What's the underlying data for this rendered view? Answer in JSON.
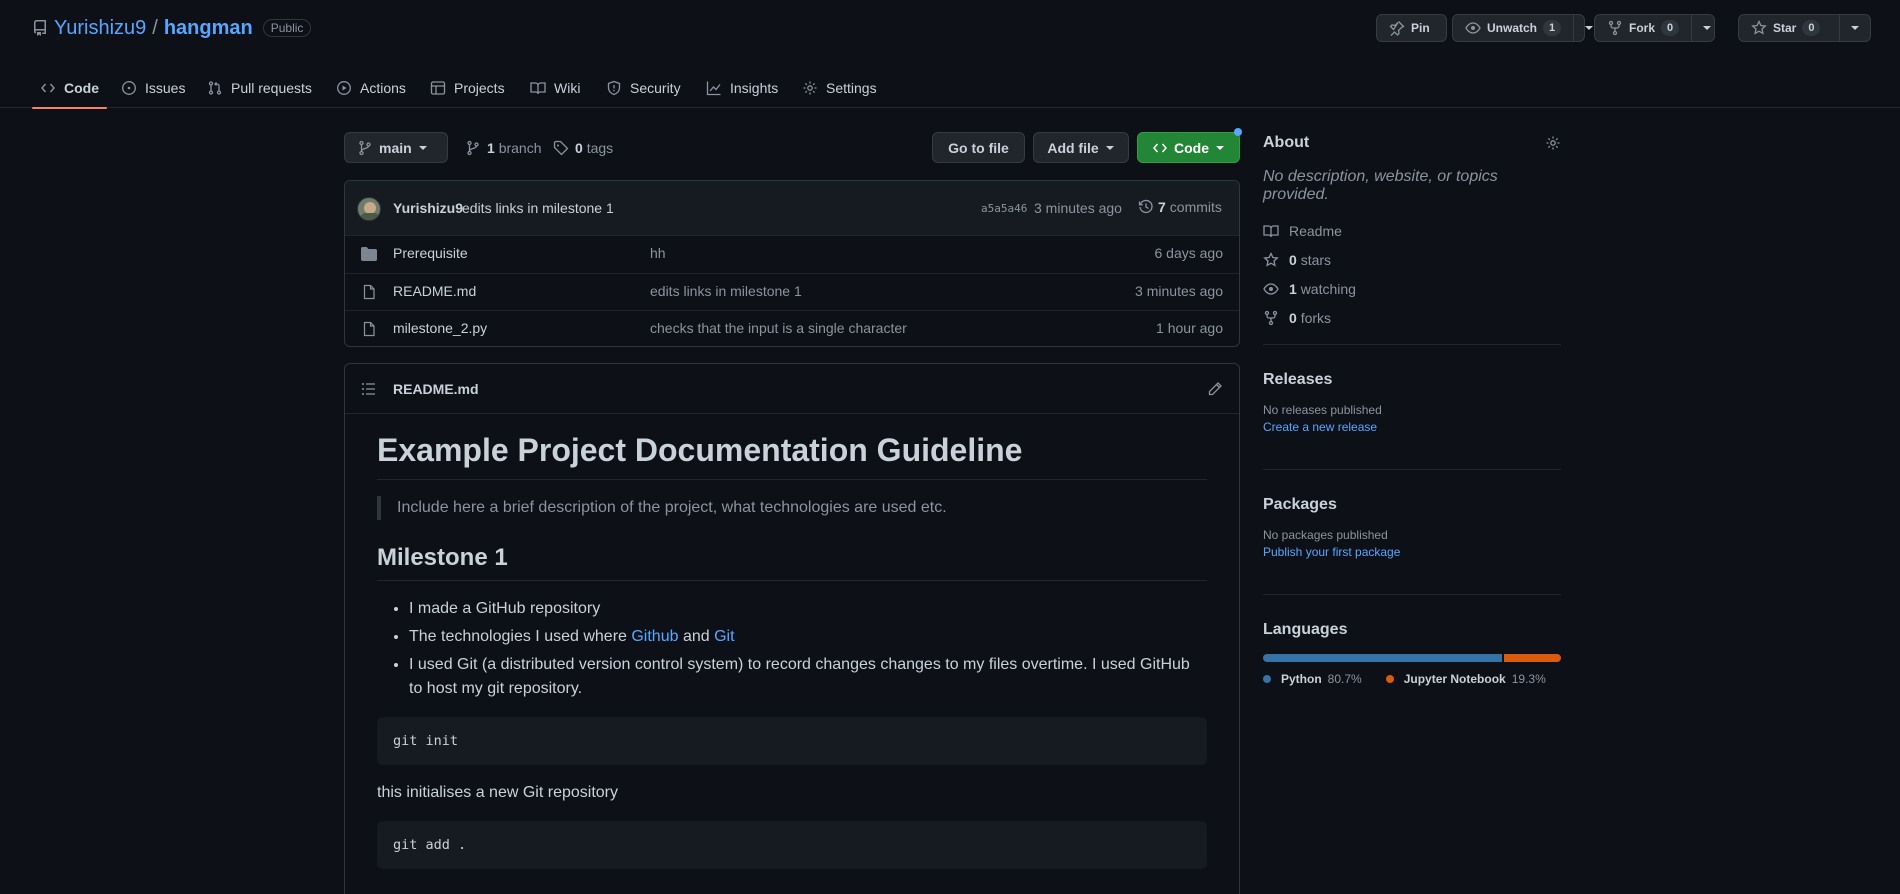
{
  "repo": {
    "owner": "Yurishizu9",
    "separator": "/",
    "name": "hangman",
    "visibility": "Public"
  },
  "actions": {
    "pin": "Pin",
    "unwatch": "Unwatch",
    "watch_count": "1",
    "fork": "Fork",
    "fork_count": "0",
    "star": "Star",
    "star_count": "0"
  },
  "tabs": [
    "Code",
    "Issues",
    "Pull requests",
    "Actions",
    "Projects",
    "Wiki",
    "Security",
    "Insights",
    "Settings"
  ],
  "filenav": {
    "branch": "main",
    "branch_count": "1",
    "branch_label": "branch",
    "tag_count": "0",
    "tag_label": "tags",
    "go_to_file": "Go to file",
    "add_file": "Add file",
    "code": "Code"
  },
  "commit": {
    "author": "Yurishizu9",
    "message": "edits links in milestone 1",
    "sha": "a5a5a46",
    "time": "3 minutes ago",
    "count": "7",
    "count_label": "commits"
  },
  "files": [
    {
      "name": "Prerequisite",
      "message": "hh",
      "time": "6 days ago",
      "icon": "folder-icon"
    },
    {
      "name": "README.md",
      "message": "edits links in milestone 1",
      "time": "3 minutes ago",
      "icon": "file-icon"
    },
    {
      "name": "milestone_2.py",
      "message": "checks that the input is a single character",
      "time": "1 hour ago",
      "icon": "file-icon"
    }
  ],
  "readme": {
    "filename": "README.md",
    "h1": "Example Project Documentation Guideline",
    "quote": "Include here a brief description of the project, what technologies are used etc.",
    "h2": "Milestone 1",
    "li1": "I made a GitHub repository",
    "li2_pre": "The technologies I used where ",
    "li2_link1": "Github",
    "li2_mid": " and ",
    "li2_link2": "Git",
    "li3": "I used Git (a distributed version control system) to record changes changes to my files overtime. I used GitHub to host my git repository.",
    "code1": "git init",
    "p1": "this initialises a new Git repository",
    "code2": "git add ."
  },
  "about": {
    "title": "About",
    "description": "No description, website, or topics provided.",
    "readme": "Readme",
    "stars_count": "0",
    "stars_label": "stars",
    "watching_count": "1",
    "watching_label": "watching",
    "forks_count": "0",
    "forks_label": "forks"
  },
  "releases": {
    "title": "Releases",
    "none": "No releases published",
    "link": "Create a new release"
  },
  "packages": {
    "title": "Packages",
    "none": "No packages published",
    "link": "Publish your first package"
  },
  "languages": {
    "title": "Languages",
    "items": [
      {
        "name": "Python",
        "percent": "80.7%",
        "fraction": 0.807,
        "color": "#3572A5"
      },
      {
        "name": "Jupyter Notebook",
        "percent": "19.3%",
        "fraction": 0.193,
        "color": "#DA5B0B"
      }
    ]
  },
  "colors": {
    "accent": "#58a6ff",
    "code_button": "#238636",
    "tab_underline": "#f78166"
  }
}
